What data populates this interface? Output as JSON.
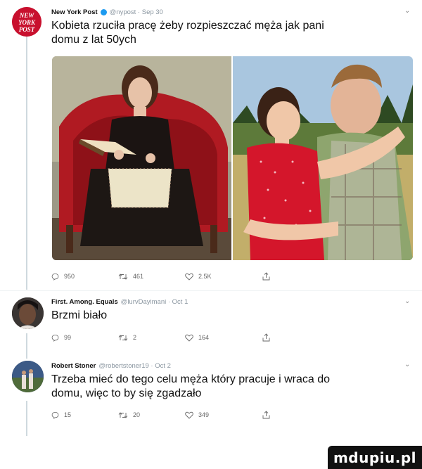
{
  "tweet": {
    "name": "New York Post",
    "handle": "@nypost · Sep 30",
    "text_line1": "Kobieta rzuciła pracę żeby rozpieszczać męża jak pani",
    "text_line2": "domu z lat 50ych",
    "replies": "950",
    "retweets": "461",
    "likes": "2.5K"
  },
  "reply1": {
    "name": "First. Among. Equals",
    "handle": "@lurvDayimani · Oct 1",
    "text": "Brzmi biało",
    "replies": "99",
    "retweets": "2",
    "likes": "164"
  },
  "reply2": {
    "name": "Robert Stoner",
    "handle": "@robertstoner19 · Oct 2",
    "text_line1": "Trzeba mieć do tego celu męża który pracuje i wraca do",
    "text_line2": "domu, więc to by się zgadzało",
    "replies": "15",
    "retweets": "20",
    "likes": "349"
  },
  "watermark": "mdupiu.pl",
  "icons": {
    "reply": "reply-icon",
    "retweet": "retweet-icon",
    "like": "heart-icon",
    "share": "share-icon",
    "more": "chevron-down-icon"
  },
  "colors": {
    "nyp_red": "#c8102e",
    "chair_red": "#b01a22",
    "dress_red": "#d4162b"
  }
}
